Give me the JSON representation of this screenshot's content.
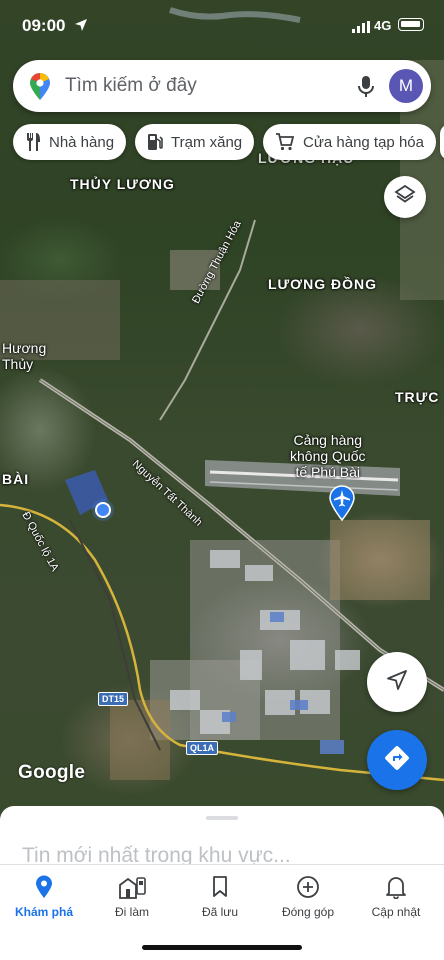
{
  "status_bar": {
    "time": "09:00",
    "network": "4G"
  },
  "search": {
    "placeholder": "Tìm kiếm ở đây",
    "avatar_initial": "M"
  },
  "chips": [
    {
      "label": "Nhà hàng",
      "icon": "restaurant-icon"
    },
    {
      "label": "Trạm xăng",
      "icon": "gas-station-icon"
    },
    {
      "label": "Cửa hàng tạp hóa",
      "icon": "cart-icon"
    }
  ],
  "map": {
    "areas": [
      "THỦY LƯƠNG",
      "LƯƠNG ĐỒNG",
      "LƯƠNG HẬU",
      "TRỰC",
      "BÀI"
    ],
    "town": "Hương\nThủy",
    "roads": [
      "Đường Thuận Hóa",
      "Nguyễn Tất Thành",
      "Đ Quốc lộ 1A"
    ],
    "shields": [
      "DT15",
      "QL1A"
    ],
    "airport": "Cảng hàng\nkhông Quốc\ntế Phú Bài",
    "attribution": "Google"
  },
  "bottom_sheet": {
    "latest": "Tin mới nhất trong khu vực..."
  },
  "nav": [
    {
      "label": "Khám phá",
      "icon": "explore-pin-icon",
      "active": true
    },
    {
      "label": "Đi làm",
      "icon": "commute-icon",
      "active": false
    },
    {
      "label": "Đã lưu",
      "icon": "bookmark-icon",
      "active": false
    },
    {
      "label": "Đóng góp",
      "icon": "add-circle-icon",
      "active": false
    },
    {
      "label": "Cập nhật",
      "icon": "bell-icon",
      "active": false
    }
  ],
  "colors": {
    "accent": "#1a73e8",
    "location_dot": "#4285f4",
    "airport_pin": "#1a73e8"
  }
}
